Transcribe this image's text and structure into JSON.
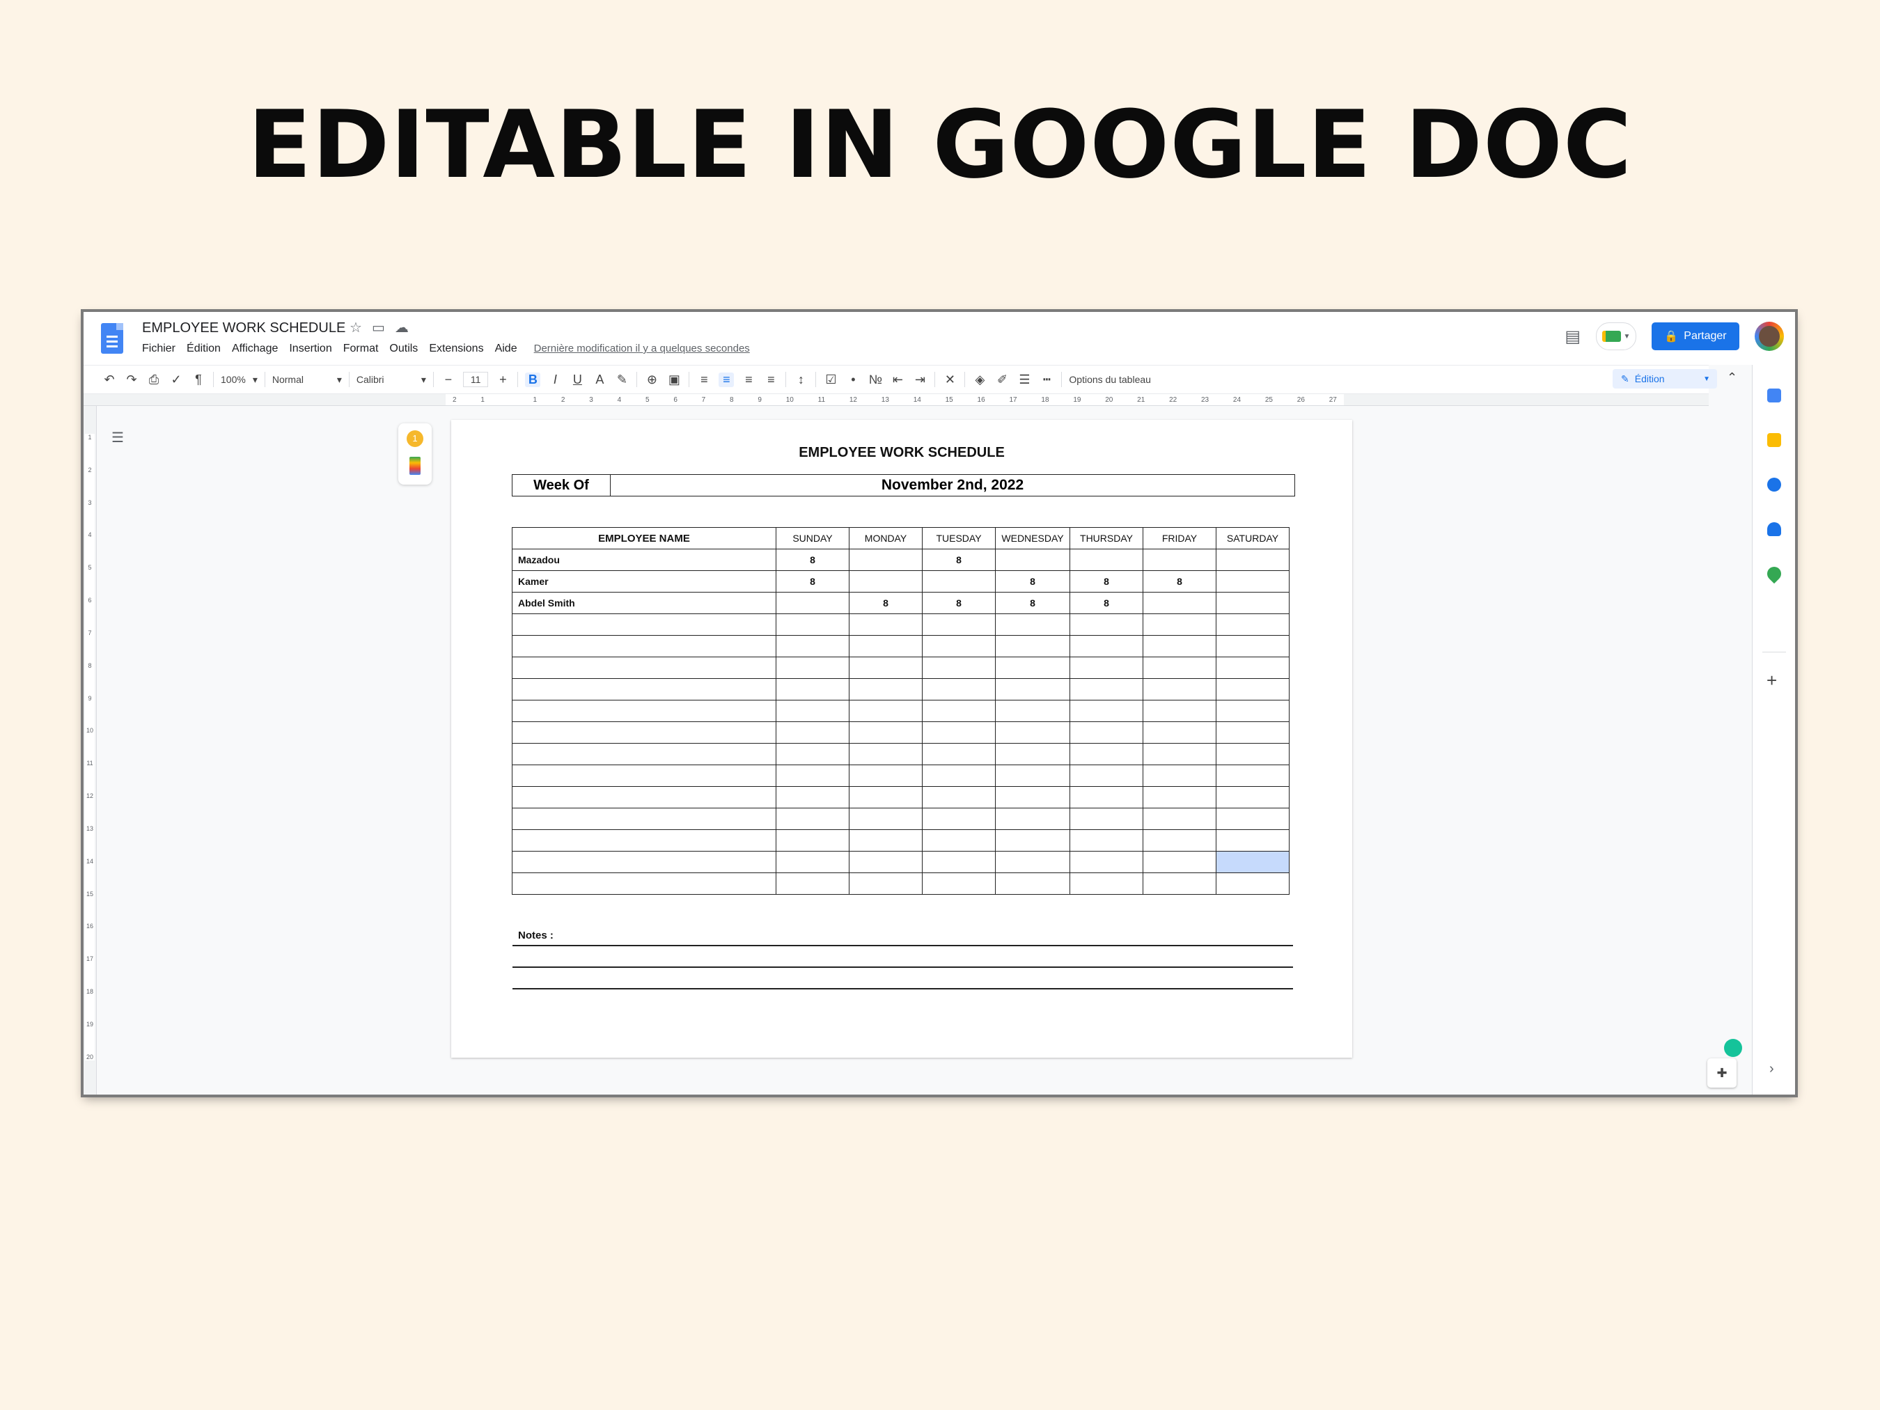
{
  "banner": "EDITABLE IN GOOGLE DOC",
  "app": {
    "title": "EMPLOYEE WORK SCHEDULE",
    "menu": [
      "Fichier",
      "Édition",
      "Affichage",
      "Insertion",
      "Format",
      "Outils",
      "Extensions",
      "Aide"
    ],
    "last_modified": "Dernière modification il y a quelques secondes",
    "share_label": "Partager",
    "mode_label": "Édition"
  },
  "toolbar": {
    "zoom": "100%",
    "style": "Normal",
    "font": "Calibri",
    "font_size": "11",
    "table_options": "Options du tableau"
  },
  "ruler": {
    "ticks": [
      "2",
      "1",
      "",
      "1",
      "2",
      "3",
      "4",
      "5",
      "6",
      "7",
      "8",
      "9",
      "10",
      "11",
      "12",
      "13",
      "14",
      "15",
      "16",
      "17",
      "18",
      "19",
      "20",
      "21",
      "22",
      "23",
      "24",
      "25",
      "26",
      "27"
    ],
    "vticks": [
      "1",
      "2",
      "3",
      "4",
      "5",
      "6",
      "7",
      "8",
      "9",
      "10",
      "11",
      "12",
      "13",
      "14",
      "15",
      "16",
      "17",
      "18",
      "19",
      "20"
    ]
  },
  "comments_badge": "1",
  "document": {
    "heading": "EMPLOYEE WORK SCHEDULE",
    "week_of_label": "Week Of",
    "week_of_value": "November 2nd, 2022",
    "columns": [
      "EMPLOYEE NAME",
      "SUNDAY",
      "MONDAY",
      "TUESDAY",
      "WEDNESDAY",
      "THURSDAY",
      "FRIDAY",
      "SATURDAY"
    ],
    "rows": [
      [
        "Mazadou",
        "8",
        "",
        "8",
        "",
        "",
        "",
        ""
      ],
      [
        "Kamer",
        "8",
        "",
        "",
        "8",
        "8",
        "8",
        ""
      ],
      [
        "Abdel Smith",
        "",
        "8",
        "8",
        "8",
        "8",
        "",
        ""
      ],
      [
        "",
        "",
        "",
        "",
        "",
        "",
        "",
        ""
      ],
      [
        "",
        "",
        "",
        "",
        "",
        "",
        "",
        ""
      ],
      [
        "",
        "",
        "",
        "",
        "",
        "",
        "",
        ""
      ],
      [
        "",
        "",
        "",
        "",
        "",
        "",
        "",
        ""
      ],
      [
        "",
        "",
        "",
        "",
        "",
        "",
        "",
        ""
      ],
      [
        "",
        "",
        "",
        "",
        "",
        "",
        "",
        ""
      ],
      [
        "",
        "",
        "",
        "",
        "",
        "",
        "",
        ""
      ],
      [
        "",
        "",
        "",
        "",
        "",
        "",
        "",
        ""
      ],
      [
        "",
        "",
        "",
        "",
        "",
        "",
        "",
        ""
      ],
      [
        "",
        "",
        "",
        "",
        "",
        "",
        "",
        ""
      ],
      [
        "",
        "",
        "",
        "",
        "",
        "",
        "",
        ""
      ],
      [
        "",
        "",
        "",
        "",
        "",
        "",
        "",
        ""
      ],
      [
        "",
        "",
        "",
        "",
        "",
        "",
        "",
        ""
      ]
    ],
    "notes_label": "Notes :"
  },
  "colors": {
    "background": "#fdf4e7",
    "accent": "#1a73e8",
    "selected_cell": "#c6dafc"
  }
}
